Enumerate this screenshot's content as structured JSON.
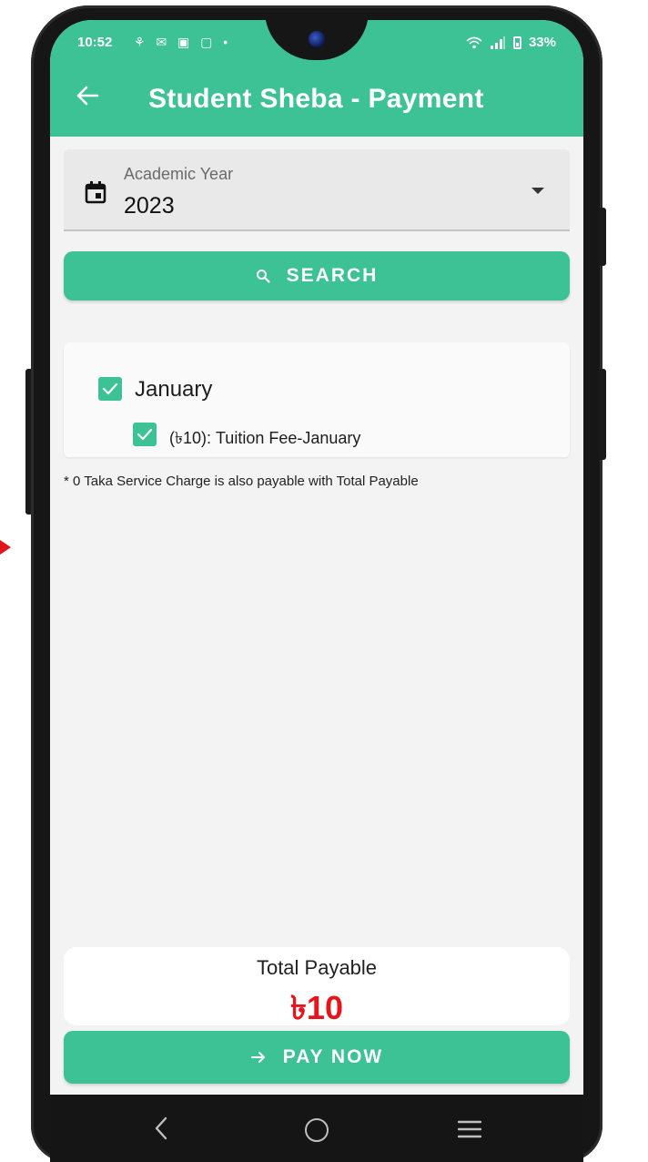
{
  "status_bar": {
    "time": "10:52",
    "notification_icons": "⚘ ✉ ▣ ▢ •",
    "battery": "33%"
  },
  "header": {
    "title": "Student Sheba - Payment"
  },
  "academic_year": {
    "label": "Academic Year",
    "value": "2023"
  },
  "search_button": {
    "label": "SEARCH"
  },
  "fees": {
    "month_label": "January",
    "month_checked": true,
    "items": [
      {
        "label": "(৳10): Tuition Fee-January",
        "checked": true
      }
    ]
  },
  "service_note": "* 0 Taka Service Charge is also payable with Total Payable",
  "total": {
    "label": "Total Payable",
    "value": "৳10"
  },
  "pay_button": {
    "label": "PAY NOW"
  },
  "colors": {
    "primary": "#3cc295",
    "total_value": "#e8141b",
    "arrow_marker": "#e0151b"
  }
}
